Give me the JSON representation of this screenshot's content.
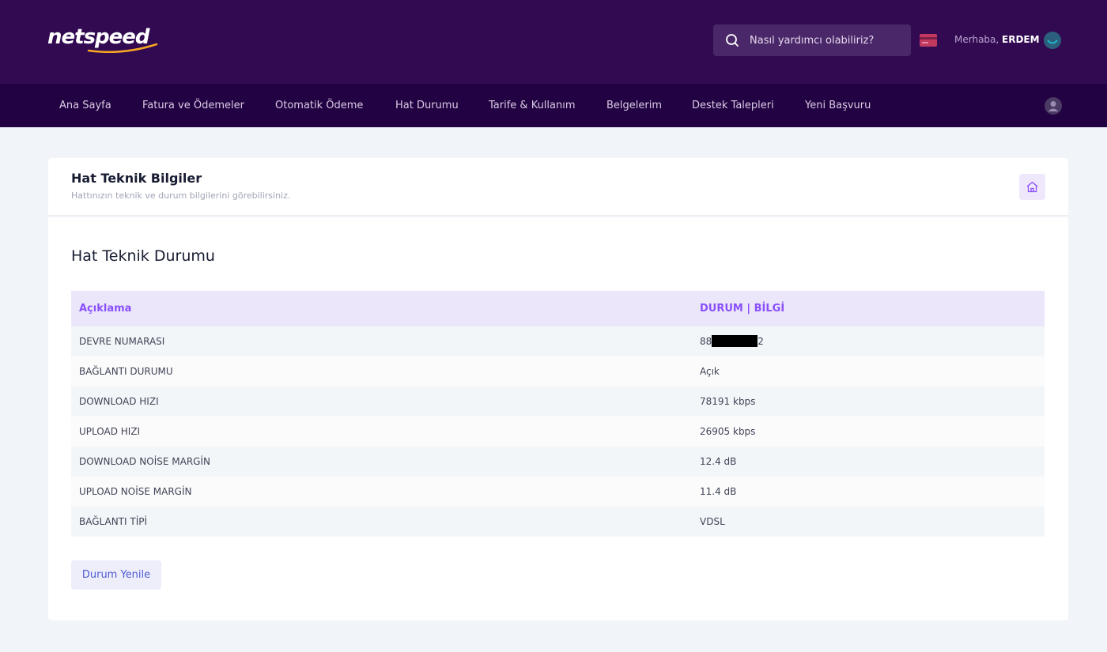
{
  "brand": {
    "logo_text": "netspeed",
    "accent": "#f5a623"
  },
  "header": {
    "search_placeholder": "Nasıl yardımcı olabiliriz?",
    "greeting_prefix": "Merhaba,",
    "user_name": "ERDEM"
  },
  "nav": {
    "items": [
      {
        "label": "Ana Sayfa"
      },
      {
        "label": "Fatura ve Ödemeler"
      },
      {
        "label": "Otomatik Ödeme"
      },
      {
        "label": "Hat Durumu"
      },
      {
        "label": "Tarife & Kullanım"
      },
      {
        "label": "Belgelerim"
      },
      {
        "label": "Destek Talepleri"
      },
      {
        "label": "Yeni Başvuru"
      }
    ]
  },
  "subheader": {
    "title": "Hat Teknik Bilgiler",
    "description": "Hattınızın teknik ve durum bilgilerini görebilirsiniz."
  },
  "main": {
    "title": "Hat Teknik Durumu",
    "table": {
      "headers": [
        "Açıklama",
        "DURUM | BİLGİ"
      ],
      "rows": [
        {
          "label": "DEVRE NUMARASI",
          "value_prefix": "88",
          "value_suffix": "2",
          "redacted": true
        },
        {
          "label": "BAĞLANTI DURUMU",
          "value": "Açık"
        },
        {
          "label": "DOWNLOAD HIZI",
          "value": "78191 kbps"
        },
        {
          "label": "UPLOAD HIZI",
          "value": "26905 kbps"
        },
        {
          "label": "DOWNLOAD NOİSE MARGİN",
          "value": "12.4 dB"
        },
        {
          "label": "UPLOAD NOİSE MARGİN",
          "value": "11.4 dB"
        },
        {
          "label": "BAĞLANTI TİPİ",
          "value": "VDSL"
        }
      ]
    },
    "refresh_button": "Durum Yenile"
  }
}
